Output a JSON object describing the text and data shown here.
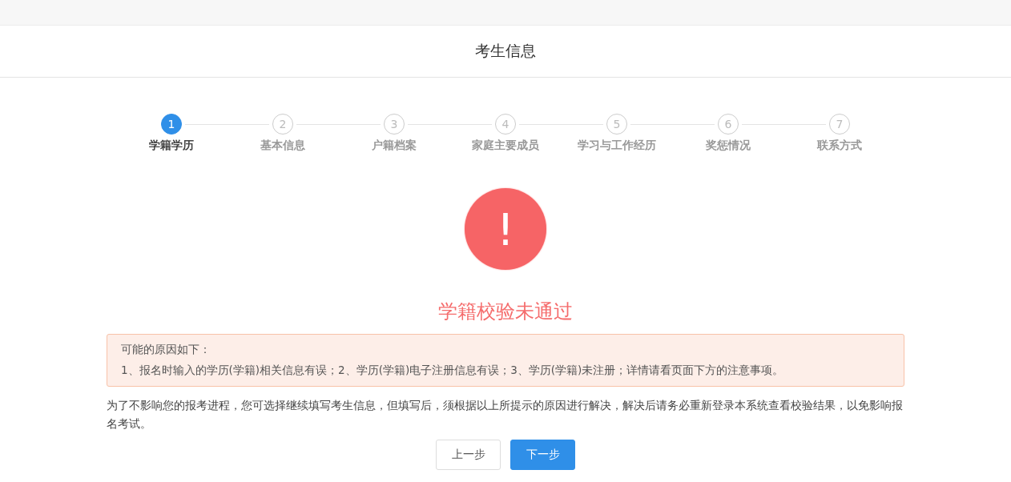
{
  "header": {
    "title": "考生信息"
  },
  "steps": [
    {
      "number": "1",
      "label": "学籍学历",
      "selected": true
    },
    {
      "number": "2",
      "label": "基本信息",
      "selected": false
    },
    {
      "number": "3",
      "label": "户籍档案",
      "selected": false
    },
    {
      "number": "4",
      "label": "家庭主要成员",
      "selected": false
    },
    {
      "number": "5",
      "label": "学习与工作经历",
      "selected": false
    },
    {
      "number": "6",
      "label": "奖惩情况",
      "selected": false
    },
    {
      "number": "7",
      "label": "联系方式",
      "selected": false
    }
  ],
  "result": {
    "icon": "!",
    "title": "学籍校验未通过"
  },
  "alert": {
    "heading": "可能的原因如下：",
    "text": "1、报名时输入的学历(学籍)相关信息有误；2、学历(学籍)电子注册信息有误；3、学历(学籍)未注册；详情请看页面下方的注意事项。"
  },
  "notice": "为了不影响您的报考进程，您可选择继续填写考生信息，但填写后，须根据以上所提示的原因进行解决，解决后请务必重新登录本系统查看校验结果，以免影响报名考试。",
  "buttons": [
    {
      "label": "上一步",
      "kind": "secondary"
    },
    {
      "label": "下一步",
      "kind": "primary"
    }
  ]
}
